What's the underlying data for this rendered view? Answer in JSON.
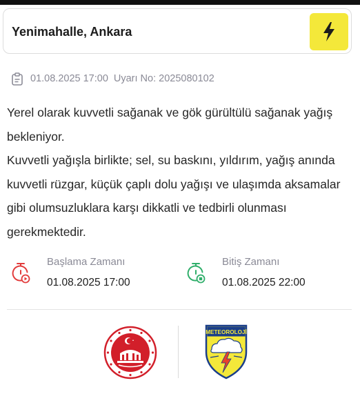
{
  "location": {
    "title": "Yenimahalle, Ankara"
  },
  "alert_meta": {
    "datetime": "01.08.2025 17:00",
    "warning_number": "Uyarı No: 2025080102"
  },
  "description": {
    "line1": "Yerel olarak kuvvetli sağanak ve gök gürültülü sağanak yağış bekleniyor.",
    "line2": "Kuvvetli yağışla birlikte; sel, su baskını, yıldırım, yağış anında kuvvetli rüzgar, küçük çaplı dolu yağışı ve ulaşımda aksamalar gibi olumsuzluklara karşı dikkatli ve tedbirli olunması gerekmektedir."
  },
  "start": {
    "label": "Başlama Zamanı",
    "value": "01.08.2025 17:00"
  },
  "end": {
    "label": "Bitiş Zamanı",
    "value": "01.08.2025 22:00"
  },
  "logos": {
    "meteoroloji_text": "METEOROLOJİ"
  },
  "colors": {
    "accent_yellow": "#f4e83a",
    "start_red": "#e23b3b",
    "end_green": "#2fae6a",
    "muted": "#8a8a96"
  },
  "icons": [
    "bolt-icon",
    "clipboard-icon",
    "timer-play-icon",
    "timer-stop-icon"
  ]
}
